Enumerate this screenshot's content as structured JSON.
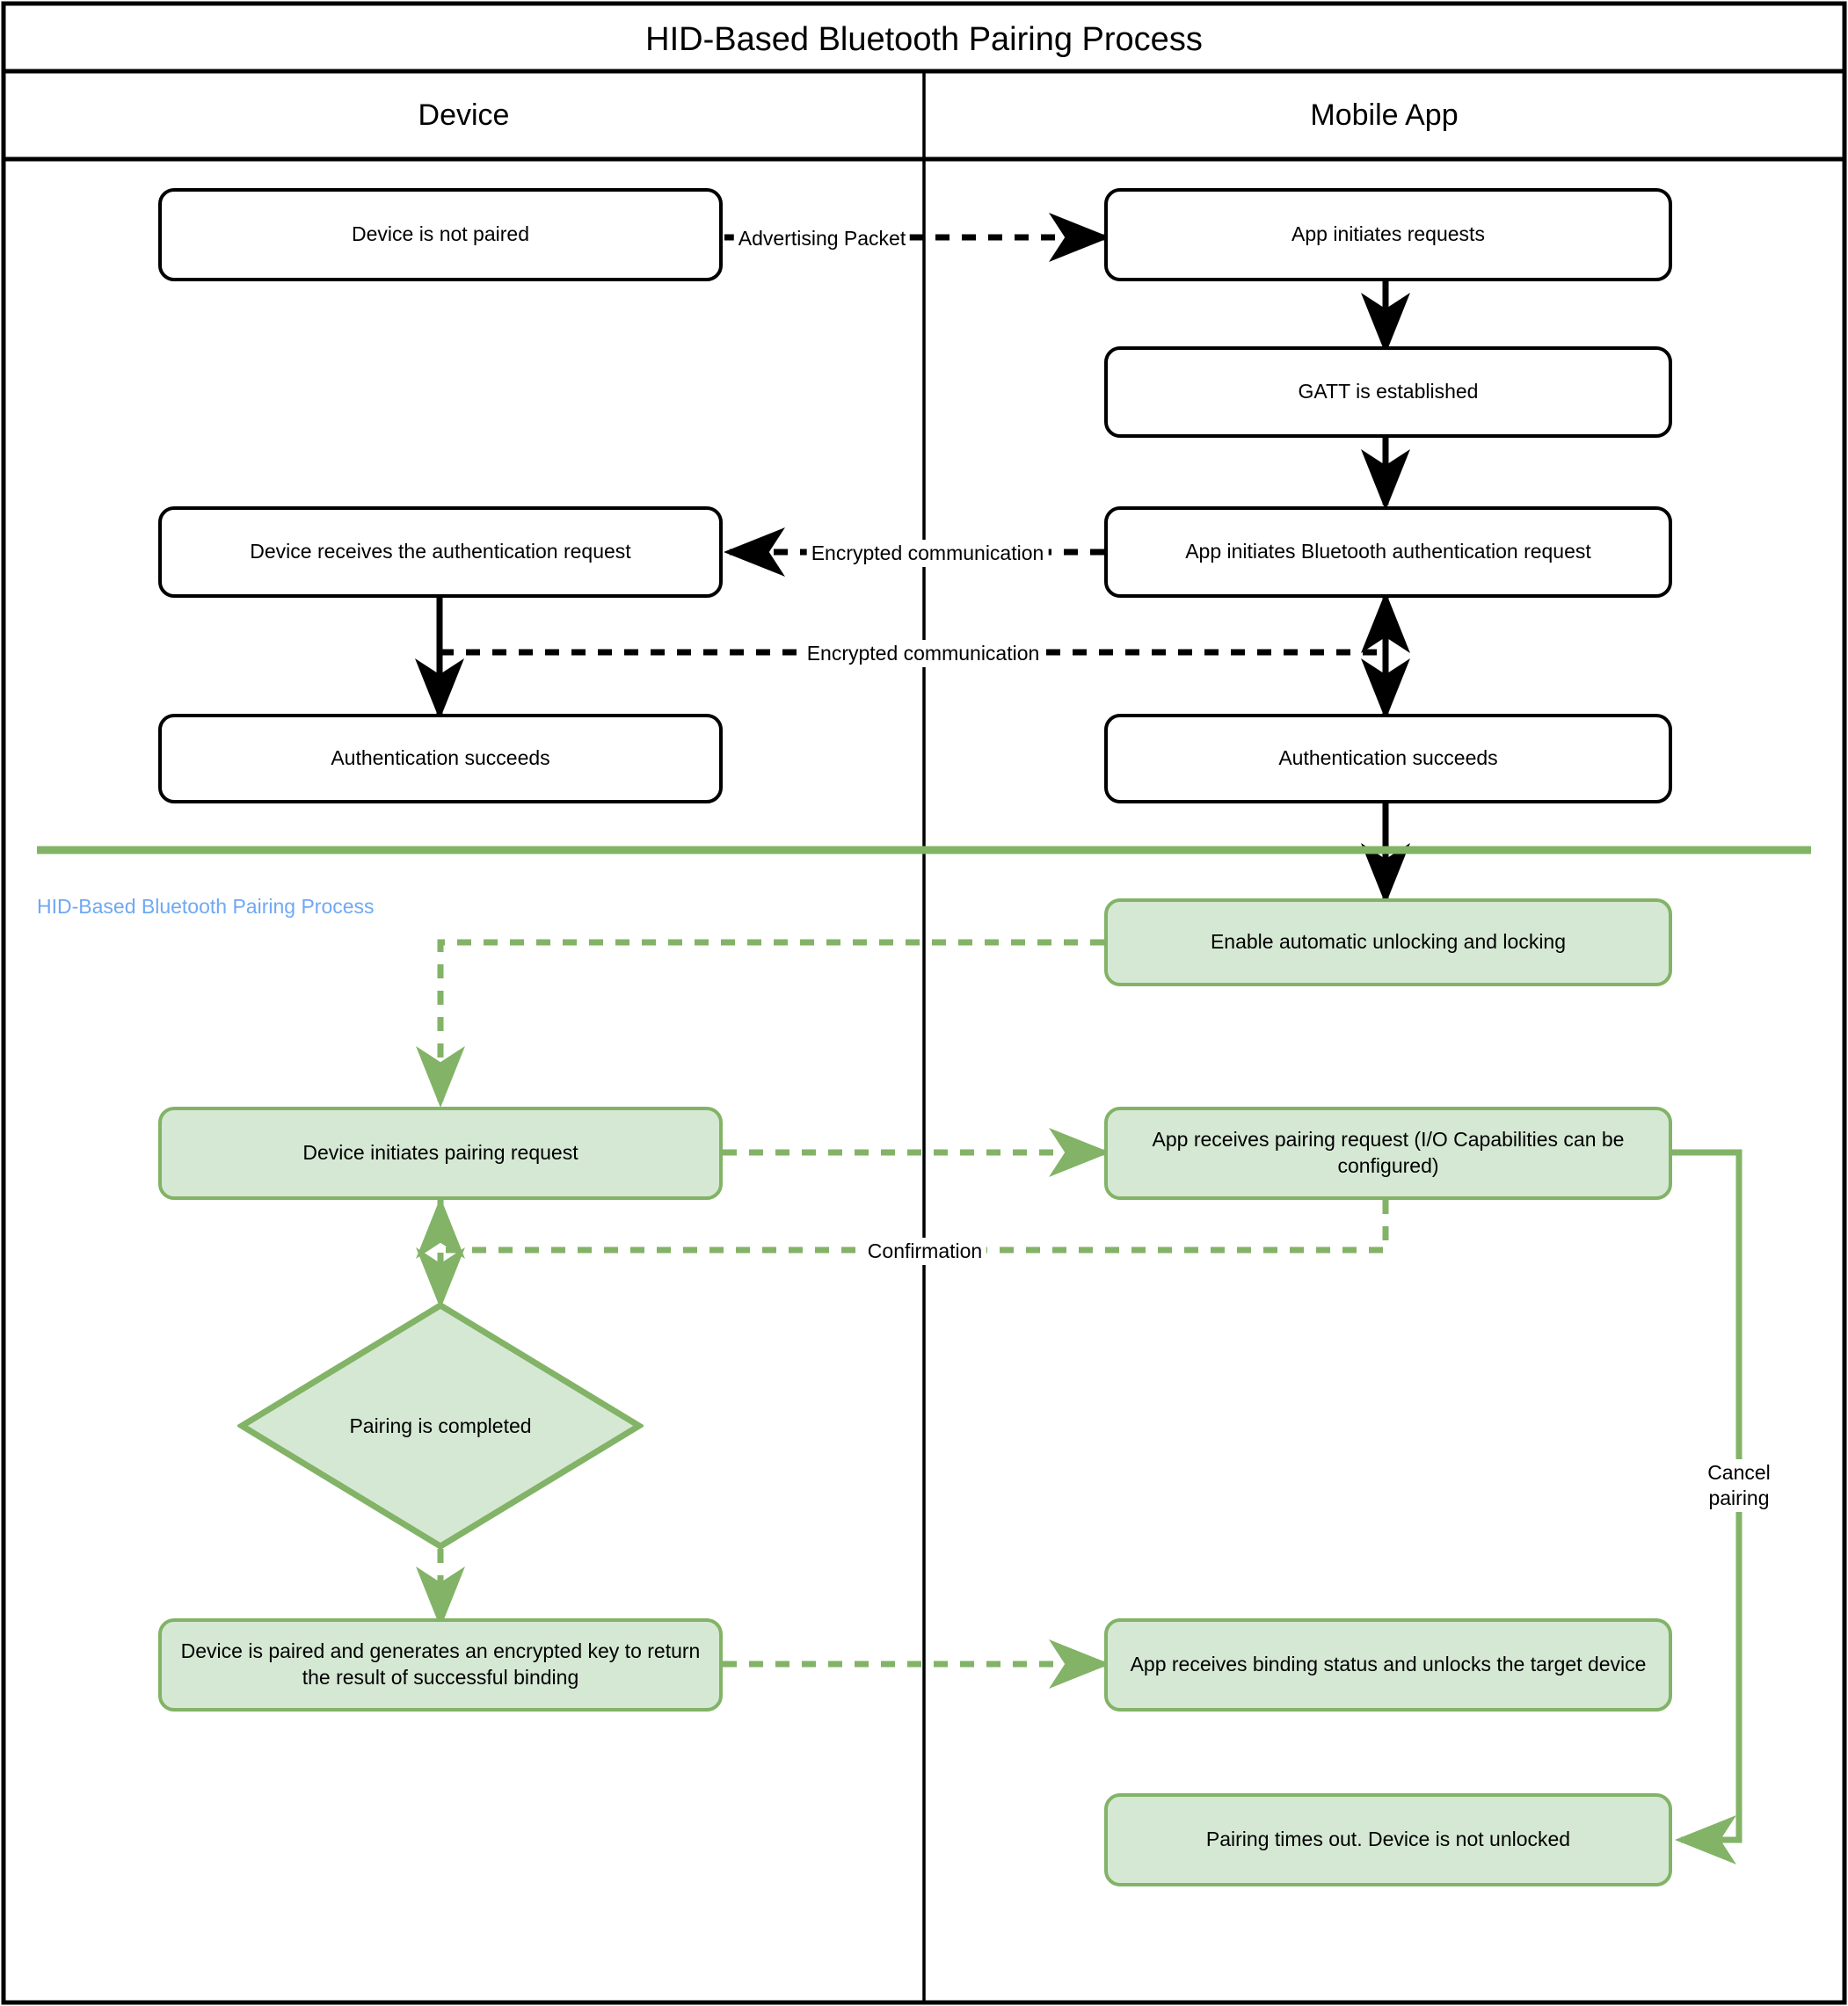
{
  "diagram": {
    "title": "HID-Based Bluetooth Pairing Process",
    "pool_label": "HID-Based Bluetooth Pairing Process",
    "lanes": [
      {
        "name": "Device"
      },
      {
        "name": "Mobile App"
      }
    ],
    "colors": {
      "stroke_black": "#000000",
      "green_stroke": "#82b366",
      "green_fill": "#d5e8d4",
      "pool_label_blue": "#6fa8f5",
      "background": "#ffffff"
    },
    "nodes": [
      {
        "id": "device_not_paired",
        "label": "Device is not paired",
        "lane": "Device",
        "style": "process"
      },
      {
        "id": "app_initiates",
        "label": "App initiates requests",
        "lane": "Mobile App",
        "style": "process"
      },
      {
        "id": "gatt",
        "label": "GATT is established",
        "lane": "Mobile App",
        "style": "process"
      },
      {
        "id": "device_recv_auth",
        "label": "Device receives the authentication request",
        "lane": "Device",
        "style": "process"
      },
      {
        "id": "app_init_bt_auth",
        "label": "App initiates Bluetooth authentication request",
        "lane": "Mobile App",
        "style": "process"
      },
      {
        "id": "auth_ok_device",
        "label": "Authentication succeeds",
        "lane": "Device",
        "style": "process"
      },
      {
        "id": "auth_ok_app",
        "label": "Authentication succeeds",
        "lane": "Mobile App",
        "style": "process"
      },
      {
        "id": "enable_auto",
        "label": "Enable automatic unlocking and locking",
        "lane": "Mobile App",
        "style": "green"
      },
      {
        "id": "device_init_pair",
        "label": "Device initiates pairing request",
        "lane": "Device",
        "style": "green"
      },
      {
        "id": "app_recv_pair",
        "label": "App receives pairing request (I/O Capabilities can be configured)",
        "lane": "Mobile App",
        "style": "green"
      },
      {
        "id": "pairing_completed",
        "label": "Pairing is completed",
        "lane": "Device",
        "style": "green-diamond"
      },
      {
        "id": "device_paired_key",
        "label": "Device is paired and generates an encrypted key to return the result of successful binding",
        "lane": "Device",
        "style": "green"
      },
      {
        "id": "app_recv_binding",
        "label": "App receives binding status and unlocks the target device",
        "lane": "Mobile App",
        "style": "green"
      },
      {
        "id": "pairing_timeout",
        "label": "Pairing times out. Device is not unlocked",
        "lane": "Mobile App",
        "style": "green"
      }
    ],
    "edges": [
      {
        "from": "device_not_paired",
        "to": "app_initiates",
        "label": "Advertising Packet",
        "style": "dashed-black"
      },
      {
        "from": "app_initiates",
        "to": "gatt",
        "label": "",
        "style": "solid-black"
      },
      {
        "from": "gatt",
        "to": "app_init_bt_auth",
        "label": "",
        "style": "solid-black"
      },
      {
        "from": "app_init_bt_auth",
        "to": "device_recv_auth",
        "label": "Encrypted communication",
        "style": "dashed-black"
      },
      {
        "from": "device_recv_auth",
        "to": "auth_ok_device",
        "label": "",
        "style": "solid-black"
      },
      {
        "from": "device_recv_auth",
        "to": "app_init_bt_auth",
        "label": "Encrypted communication",
        "style": "dashed-black"
      },
      {
        "from": "auth_ok_app",
        "to": "app_init_bt_auth",
        "label": "",
        "style": "solid-black-bidir"
      },
      {
        "from": "auth_ok_app",
        "to": "enable_auto",
        "label": "",
        "style": "solid-black"
      },
      {
        "from": "enable_auto",
        "to": "device_init_pair",
        "label": "",
        "style": "dashed-green"
      },
      {
        "from": "device_init_pair",
        "to": "app_recv_pair",
        "label": "",
        "style": "dashed-green"
      },
      {
        "from": "app_recv_pair",
        "to": "device_init_pair",
        "label": "Confirmation",
        "style": "dashed-green"
      },
      {
        "from": "device_init_pair",
        "to": "pairing_completed",
        "label": "",
        "style": "dashed-green"
      },
      {
        "from": "pairing_completed",
        "to": "device_paired_key",
        "label": "",
        "style": "dashed-green"
      },
      {
        "from": "device_paired_key",
        "to": "app_recv_binding",
        "label": "",
        "style": "dashed-green"
      },
      {
        "from": "app_recv_pair",
        "to": "pairing_timeout",
        "label": "Cancel pairing",
        "style": "solid-green"
      }
    ],
    "edge_labels": {
      "advertising_packet": "Advertising Packet",
      "encrypted_communication_1": "Encrypted communication",
      "encrypted_communication_2": "Encrypted communication",
      "confirmation": "Confirmation",
      "cancel_pairing": "Cancel\npairing",
      "cancel_pairing_line1": "Cancel",
      "cancel_pairing_line2": "pairing"
    }
  }
}
